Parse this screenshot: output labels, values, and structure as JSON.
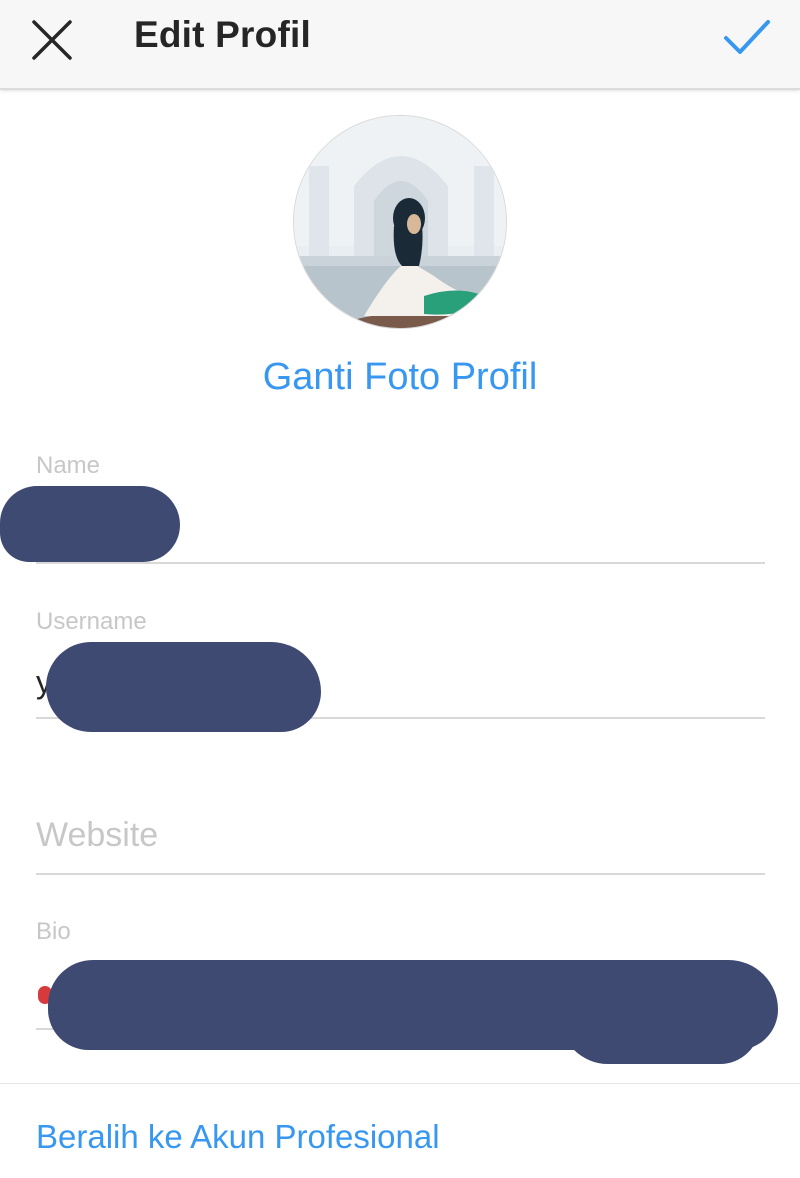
{
  "header": {
    "title": "Edit Profil",
    "close_icon": "close-icon",
    "confirm_icon": "checkmark-icon",
    "accent_color": "#3897f0"
  },
  "profile": {
    "change_photo_label": "Ganti Foto Profil"
  },
  "fields": {
    "name": {
      "label": "Name",
      "value": ""
    },
    "username": {
      "label": "Username",
      "value": "y"
    },
    "website": {
      "label": "",
      "placeholder": "Website",
      "value": ""
    },
    "bio": {
      "label": "Bio",
      "value": ""
    }
  },
  "footer": {
    "switch_account_label": "Beralih ke Akun Profesional"
  }
}
